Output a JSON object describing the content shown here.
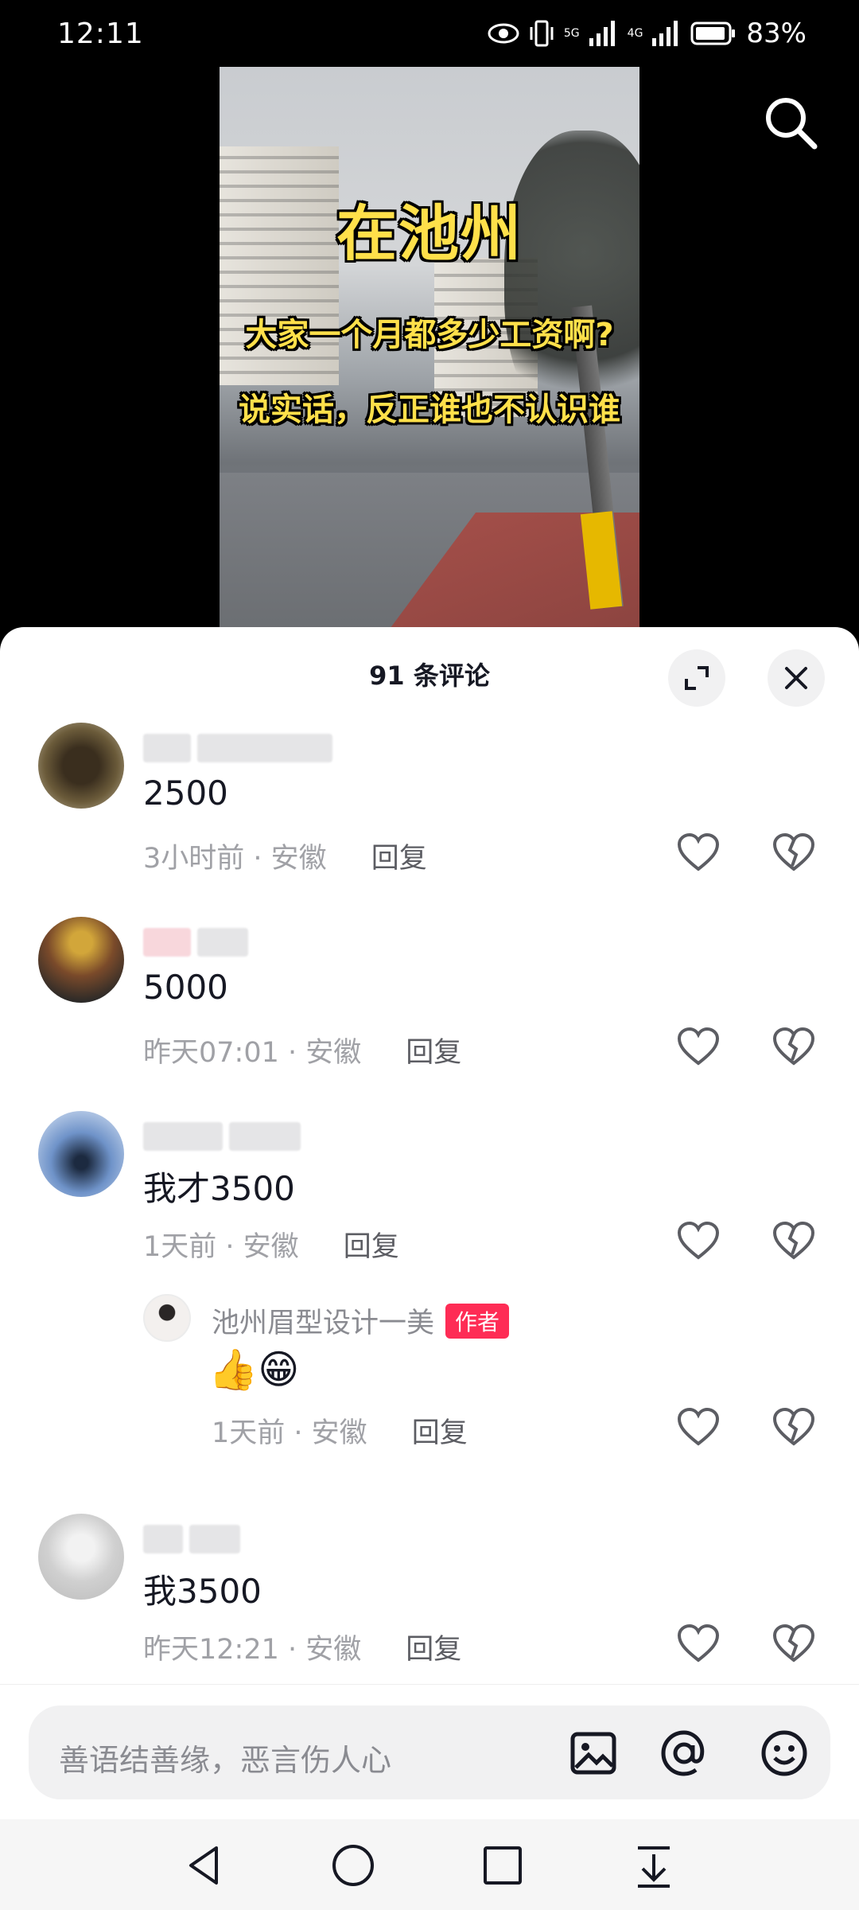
{
  "status_bar": {
    "time": "12:11",
    "battery": "83%",
    "network_1": "5G",
    "network_2": "4G"
  },
  "video": {
    "overlay_title": "在池州",
    "overlay_line_1": "大家一个月都多少工资啊?",
    "overlay_line_2": "说实话，反正谁也不认识谁",
    "search_icon": "search-icon"
  },
  "sheet": {
    "title": "91 条评论",
    "expand_icon": "expand-icon",
    "close_icon": "close-icon"
  },
  "comments": [
    {
      "text": "2500",
      "time": "3小时前",
      "location": "安徽",
      "reply": "回复"
    },
    {
      "text": "5000",
      "time": "昨天07:01",
      "location": "安徽",
      "reply": "回复"
    },
    {
      "text": "我才3500",
      "time": "1天前",
      "location": "安徽",
      "reply": "回复",
      "sub_reply": {
        "name": "池州眉型设计一美",
        "tag": "作者",
        "text": "👍😁",
        "time": "1天前",
        "location": "安徽",
        "reply": "回复"
      }
    },
    {
      "text": "我3500",
      "time": "昨天12:21",
      "location": "安徽",
      "reply": "回复"
    }
  ],
  "input": {
    "placeholder": "善语结善缘，恶言伤人心",
    "icons": [
      "image-icon",
      "at-icon",
      "emoji-icon"
    ]
  },
  "nav": {
    "icons": [
      "back-icon",
      "home-icon",
      "recents-icon",
      "notification-pull-icon"
    ]
  },
  "colors": {
    "accent": "#fe2c55",
    "meta_text": "#a0a1a6",
    "reply_text": "#5c5d63",
    "sheet_bg": "#ffffff"
  }
}
